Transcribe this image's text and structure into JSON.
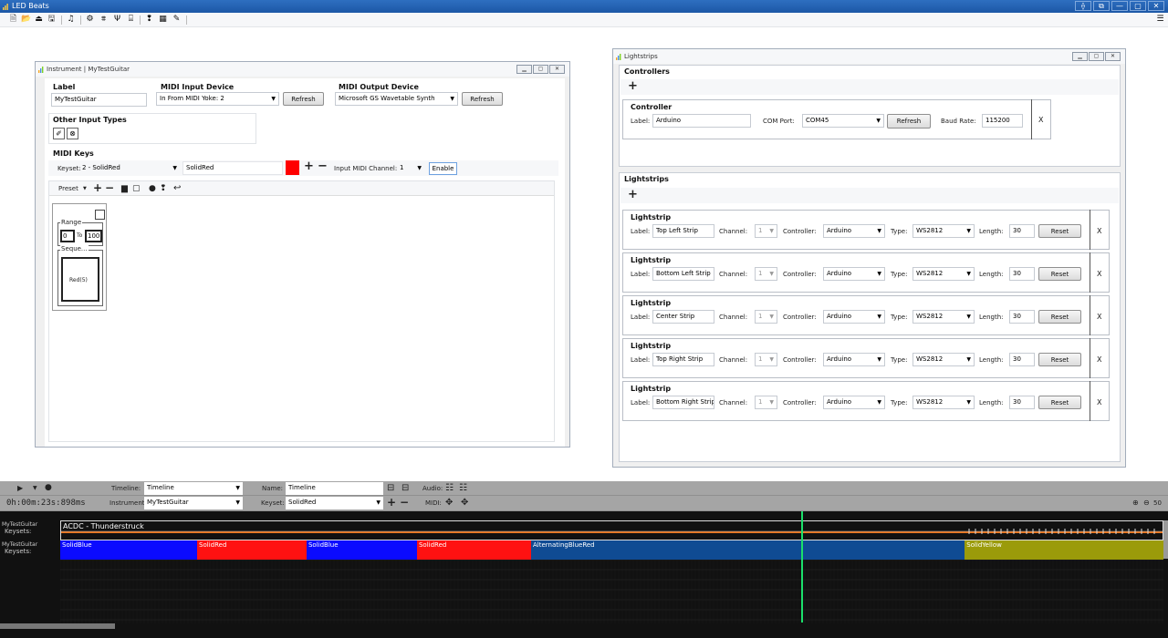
{
  "app": {
    "title": "LED Beats"
  },
  "window_buttons": [
    "⟠",
    "⧉",
    "—",
    "▢",
    "✕"
  ],
  "toolbar": {
    "icons": [
      "new-file-icon",
      "open-folder-icon",
      "upload-icon",
      "save-icon",
      "music-note-icon",
      "gear-icon",
      "equalizer-icon",
      "strip-icon",
      "tree-icon",
      "led-icon",
      "keypad-icon",
      "pencil-icon"
    ],
    "glyphs": [
      "🗎",
      "📂",
      "⏏",
      "🖫",
      "♫",
      "⚙",
      "⩨",
      "Ψ",
      "⌸",
      "❢",
      "▦",
      "✎"
    ]
  },
  "instrument": {
    "title": "Instrument | MyTestGuitar",
    "label_header": "Label",
    "label_value": "MyTestGuitar",
    "midi_in_header": "MIDI Input Device",
    "midi_in_value": "In From MIDI Yoke:  2",
    "midi_out_header": "MIDI Output Device",
    "midi_out_value": "Microsoft GS Wavetable Synth",
    "refresh_label": "Refresh",
    "other_header": "Other Input Types",
    "midi_keys_header": "MIDI Keys",
    "keyset_label": "Keyset:",
    "keyset_value": "2 - SolidRed",
    "keyset_name": "SolidRed",
    "keyset_color": "#ff0000",
    "input_channel_label": "Input MIDI Channel:",
    "input_channel_value": "1",
    "enable_label": "Enable",
    "preset_label": "Preset",
    "range_label": "Range",
    "range_from": "0",
    "range_to_label": "To",
    "range_to": "100",
    "sequence_label": "Seque...",
    "sequence_item": "Red(5)"
  },
  "lightstrips_window": {
    "title": "Lightstrips",
    "controllers_header": "Controllers",
    "controller": {
      "header": "Controller",
      "label_label": "Label:",
      "label_value": "Arduino",
      "com_label": "COM Port:",
      "com_value": "COM45",
      "refresh_label": "Refresh",
      "baud_label": "Baud Rate:",
      "baud_value": "115200",
      "remove": "X"
    },
    "lightstrips_header": "Lightstrips",
    "strip_header": "Lightstrip",
    "label_label": "Label:",
    "channel_label": "Channel:",
    "controller_label": "Controller:",
    "type_label": "Type:",
    "length_label": "Length:",
    "reset_label": "Reset",
    "remove": "X",
    "strips": [
      {
        "label": "Top Left Strip",
        "channel": "1",
        "controller": "Arduino",
        "type": "WS2812",
        "length": "30"
      },
      {
        "label": "Bottom Left Strip",
        "channel": "1",
        "controller": "Arduino",
        "type": "WS2812",
        "length": "30"
      },
      {
        "label": "Center Strip",
        "channel": "1",
        "controller": "Arduino",
        "type": "WS2812",
        "length": "30"
      },
      {
        "label": "Top Right Strip",
        "channel": "1",
        "controller": "Arduino",
        "type": "WS2812",
        "length": "30"
      },
      {
        "label": "Bottom Right Strip",
        "channel": "1",
        "controller": "Arduino",
        "type": "WS2812",
        "length": "30"
      }
    ]
  },
  "timeline": {
    "timeline_label": "Timeline:",
    "timeline_value": "Timeline",
    "name_label": "Name:",
    "name_value": "Timeline",
    "audio_label": "Audio:",
    "time": "0h:00m:23s:898ms",
    "instrument_label": "Instrument:",
    "instrument_value": "MyTestGuitar",
    "keyset_label": "Keyset:",
    "keyset_value": "SolidRed",
    "midi_label": "MIDI:",
    "zoom_value": "50",
    "audio_track_label": "MyTestGuitar",
    "audio_track_sub": "Keysets:",
    "audio_track_title": "ACDC - Thunderstruck",
    "keyset_track_label": "MyTestGuitar",
    "keyset_track_sub": "Keysets:",
    "segments": [
      {
        "label": "SolidBlue",
        "color": "#0b0bff",
        "start": 0.0,
        "end": 0.1241
      },
      {
        "label": "SolidRed",
        "color": "#ff1111",
        "start": 0.1241,
        "end": 0.2233
      },
      {
        "label": "SolidBlue",
        "color": "#0b0bff",
        "start": 0.2233,
        "end": 0.3234
      },
      {
        "label": "SolidRed",
        "color": "#ff1111",
        "start": 0.3234,
        "end": 0.4268
      },
      {
        "label": "AlternatingBlueRed",
        "color": "#0f4b93",
        "start": 0.4268,
        "end": 0.8199
      },
      {
        "label": "SolidYellow",
        "color": "#9b9b0a",
        "start": 0.8199,
        "end": 1.0
      }
    ],
    "playhead": 0.672
  }
}
